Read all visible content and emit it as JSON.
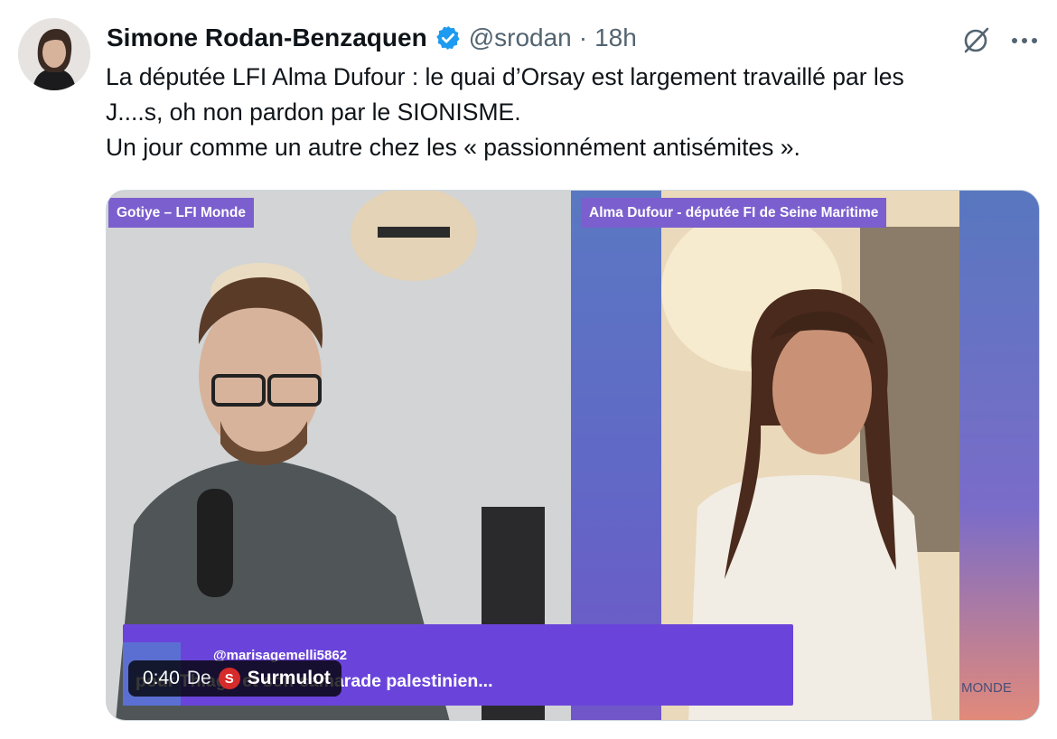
{
  "tweet": {
    "author_name": "Simone Rodan-Benzaquen",
    "handle": "@srodan",
    "separator": "·",
    "time": "18h",
    "verified_color": "#1d9bf0",
    "text_lines": [
      "La députée LFI Alma Dufour : le quai d’Orsay est largement travaillé par les",
      "J....s, oh non pardon par le SIONISME.",
      "Un jour comme un autre chez les « passionnément antisémites »."
    ]
  },
  "media": {
    "left_label": "Gotiye – LFI Monde",
    "right_label": "Alma Dufour - députée FI de Seine Maritime",
    "banner_user": "@marisagemelli5862",
    "banner_text": "pour Thiago et son camarade palestinien...",
    "corner_text": "MONDE",
    "accent_color": "#7b5fce",
    "banner_color": "#6a44da",
    "video_time": "0:40",
    "from_label": "De",
    "source_logo_letter": "S",
    "source_name": "Surmulot"
  },
  "icons": {
    "grok": "grok-icon",
    "more": "more-icon",
    "verified": "verified-badge-icon"
  }
}
